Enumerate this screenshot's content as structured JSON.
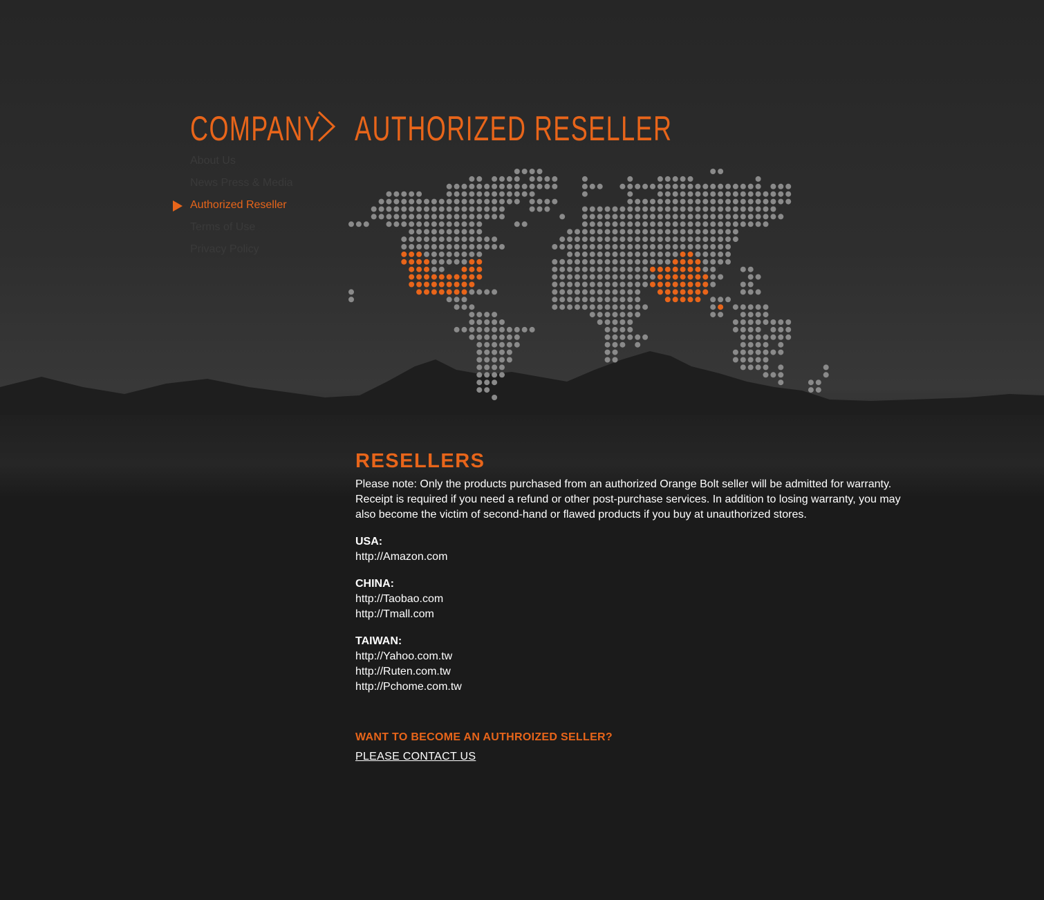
{
  "breadcrumb": {
    "section": "COMPANY",
    "current": "AUTHORIZED RESELLER"
  },
  "sidebar": {
    "items": [
      {
        "label": "About Us",
        "active": false
      },
      {
        "label": "News Press & Media",
        "active": false
      },
      {
        "label": "Authorized Reseller",
        "active": true
      },
      {
        "label": "Terms of Use",
        "active": false
      },
      {
        "label": "Privacy Policy",
        "active": false
      }
    ]
  },
  "map": {
    "highlight_regions": [
      "USA",
      "China"
    ],
    "dot_color": "#8a8a8a",
    "highlight_color": "#e8651a"
  },
  "resellers": {
    "title": "RESELLERS",
    "note": "Please note: Only the products purchased from an authorized Orange Bolt seller will be admitted for warranty. Receipt is required if you need a refund or other post-purchase services. In addition to losing warranty, you may also become the victim of second-hand or flawed products if you buy at unauthorized stores.",
    "regions": [
      {
        "name": "USA:",
        "links": [
          "http://Amazon.com"
        ]
      },
      {
        "name": "CHINA:",
        "links": [
          "http://Taobao.com",
          "http://Tmall.com"
        ]
      },
      {
        "name": "TAIWAN:",
        "links": [
          "http://Yahoo.com.tw",
          "http://Ruten.com.tw",
          "http://Pchome.com.tw"
        ]
      }
    ]
  },
  "cta": {
    "question": "WANT TO BECOME AN AUTHROIZED SELLER?",
    "link": "PLEASE CONTACT US"
  },
  "colors": {
    "accent": "#e8651a",
    "background": "#1b1b1b",
    "text": "#ffffff",
    "nav_inactive": "#3a3a3a"
  }
}
